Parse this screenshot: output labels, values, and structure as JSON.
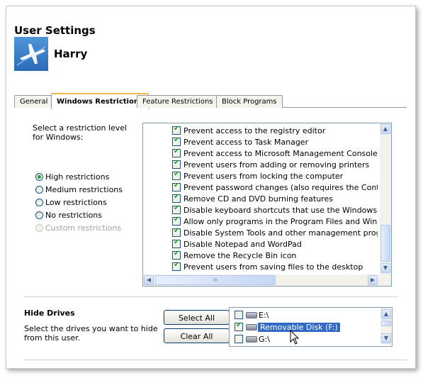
{
  "window": {
    "title": "User Settings",
    "user_name": "Harry",
    "avatar_icon": "airplane-icon"
  },
  "tabs": [
    {
      "label": "General",
      "active": false
    },
    {
      "label": "Windows Restrictions",
      "active": true
    },
    {
      "label": "Feature Restrictions",
      "active": false
    },
    {
      "label": "Block Programs",
      "active": false
    }
  ],
  "restrictions": {
    "prompt": "Select a restriction level for Windows:",
    "levels": [
      {
        "label": "High restrictions",
        "selected": true,
        "enabled": true
      },
      {
        "label": "Medium restrictions",
        "selected": false,
        "enabled": true
      },
      {
        "label": "Low restrictions",
        "selected": false,
        "enabled": true
      },
      {
        "label": "No restrictions",
        "selected": false,
        "enabled": true
      },
      {
        "label": "Custom restrictions",
        "selected": false,
        "enabled": false
      }
    ],
    "items": [
      {
        "label": "Prevent access to the registry editor",
        "checked": true
      },
      {
        "label": "Prevent access to Task Manager",
        "checked": true
      },
      {
        "label": "Prevent access to Microsoft Management Console utilities",
        "checked": true
      },
      {
        "label": "Prevent users from adding or removing printers",
        "checked": true
      },
      {
        "label": "Prevent users from locking the computer",
        "checked": true
      },
      {
        "label": "Prevent password changes (also requires the Control Pane",
        "checked": true
      },
      {
        "label": "Remove CD and DVD burning features",
        "checked": true
      },
      {
        "label": "Disable keyboard shortcuts that use the Windows Logo ke",
        "checked": true
      },
      {
        "label": "Allow only programs in the Program Files and Windows fold",
        "checked": true
      },
      {
        "label": "Disable System Tools and other management programs",
        "checked": true
      },
      {
        "label": "Disable Notepad and WordPad",
        "checked": true
      },
      {
        "label": "Remove the Recycle Bin icon",
        "checked": true
      },
      {
        "label": "Prevent users from saving files to the desktop",
        "checked": true
      }
    ],
    "hscroll_grip": "III"
  },
  "hide_drives": {
    "title": "Hide Drives",
    "description": "Select the drives you want to hide from this user.",
    "select_all_label": "Select All",
    "clear_all_label": "Clear All",
    "drives": [
      {
        "label": "E:\\",
        "checked": false,
        "highlighted": false
      },
      {
        "label": "Removable Disk (F:)",
        "checked": true,
        "highlighted": true
      },
      {
        "label": "G:\\",
        "checked": false,
        "highlighted": false
      }
    ]
  },
  "colors": {
    "tab_accent": "#f7b64b",
    "selection": "#316ac5",
    "check": "#21a121"
  }
}
